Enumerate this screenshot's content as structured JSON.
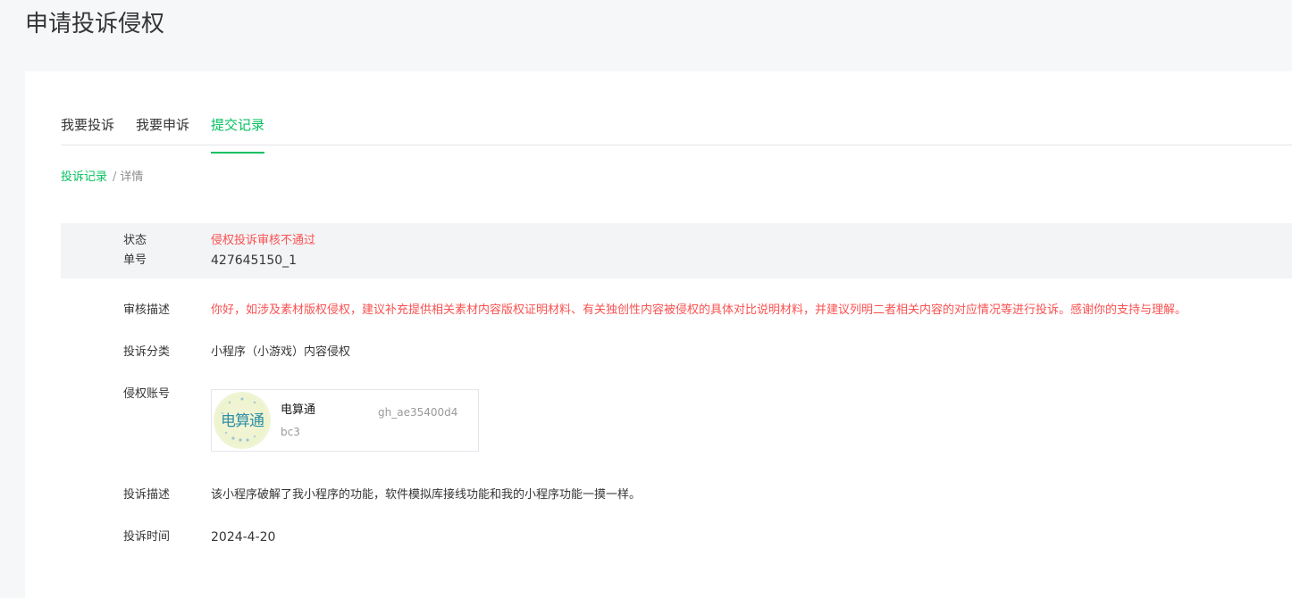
{
  "page": {
    "title": "申请投诉侵权"
  },
  "tabs": [
    {
      "label": "我要投诉",
      "active": false
    },
    {
      "label": "我要申诉",
      "active": false
    },
    {
      "label": "提交记录",
      "active": true
    }
  ],
  "breadcrumb": {
    "parent": "投诉记录",
    "separator": "/",
    "current": "详情"
  },
  "detail": {
    "status": {
      "label": "状态",
      "value": "侵权投诉审核不通过"
    },
    "order_no": {
      "label": "单号",
      "value": "427645150_1"
    },
    "review": {
      "label": "审核描述",
      "value": "你好，如涉及素材版权侵权，建议补充提供相关素材内容版权证明材料、有关独创性内容被侵权的具体对比说明材料，并建议列明二者相关内容的对应情况等进行投诉。感谢你的支持与理解。"
    },
    "category": {
      "label": "投诉分类",
      "value": "小程序（小游戏）内容侵权"
    },
    "account": {
      "label": "侵权账号",
      "name": "电算通",
      "id": "gh_ae35400d4bc3",
      "logo_text": "电算通"
    },
    "description": {
      "label": "投诉描述",
      "value": "该小程序破解了我小程序的功能，软件模拟库接线功能和我的小程序功能一摸一样。"
    },
    "time": {
      "label": "投诉时间",
      "value": "2024-4-20"
    }
  },
  "colors": {
    "accent": "#07c160",
    "error": "#fa5151",
    "text": "#353535",
    "muted": "#9a9a9a",
    "background": "#f6f7f9",
    "status_bg": "#f3f4f6"
  }
}
